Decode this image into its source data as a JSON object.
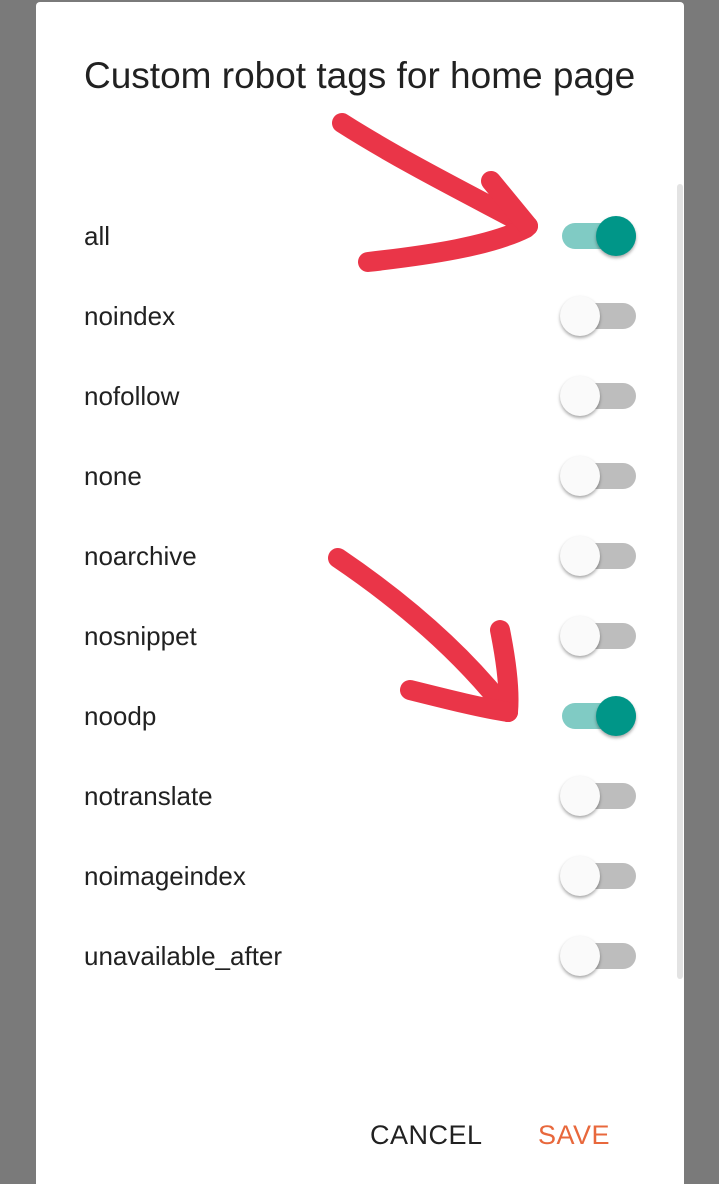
{
  "dialog": {
    "title": "Custom robot tags for home page",
    "options": [
      {
        "label": "all",
        "checked": true
      },
      {
        "label": "noindex",
        "checked": false
      },
      {
        "label": "nofollow",
        "checked": false
      },
      {
        "label": "none",
        "checked": false
      },
      {
        "label": "noarchive",
        "checked": false
      },
      {
        "label": "nosnippet",
        "checked": false
      },
      {
        "label": "noodp",
        "checked": true
      },
      {
        "label": "notranslate",
        "checked": false
      },
      {
        "label": "noimageindex",
        "checked": false
      },
      {
        "label": "unavailable_after",
        "checked": false
      }
    ],
    "actions": {
      "cancel_label": "CANCEL",
      "save_label": "SAVE"
    }
  },
  "colors": {
    "switch_on_thumb": "#009688",
    "switch_on_track": "#80cbc4",
    "switch_off_track": "#bdbdbd",
    "save_text": "#e8683c",
    "annotation_arrow": "#ea3548"
  }
}
